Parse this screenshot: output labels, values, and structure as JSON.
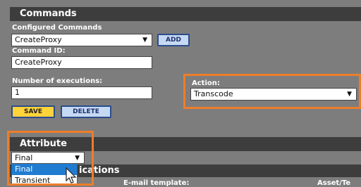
{
  "commands": {
    "header": "Commands",
    "configured_label": "Configured Commands",
    "configured_value": "CreateProxy",
    "add_label": "ADD",
    "id_label": "Command ID:",
    "id_value": "CreateProxy",
    "executions_label": "Number of executions:",
    "executions_value": "1",
    "action_label": "Action:",
    "action_value": "Transcode",
    "save_label": "SAVE",
    "delete_label": "DELETE"
  },
  "attribute": {
    "header": "Attribute",
    "selected": "Final",
    "options": [
      "Final",
      "Transient"
    ]
  },
  "notifications": {
    "header_partial": "ications",
    "email_template_label": "E-mail template:",
    "asset_label": "Asset/Te"
  }
}
